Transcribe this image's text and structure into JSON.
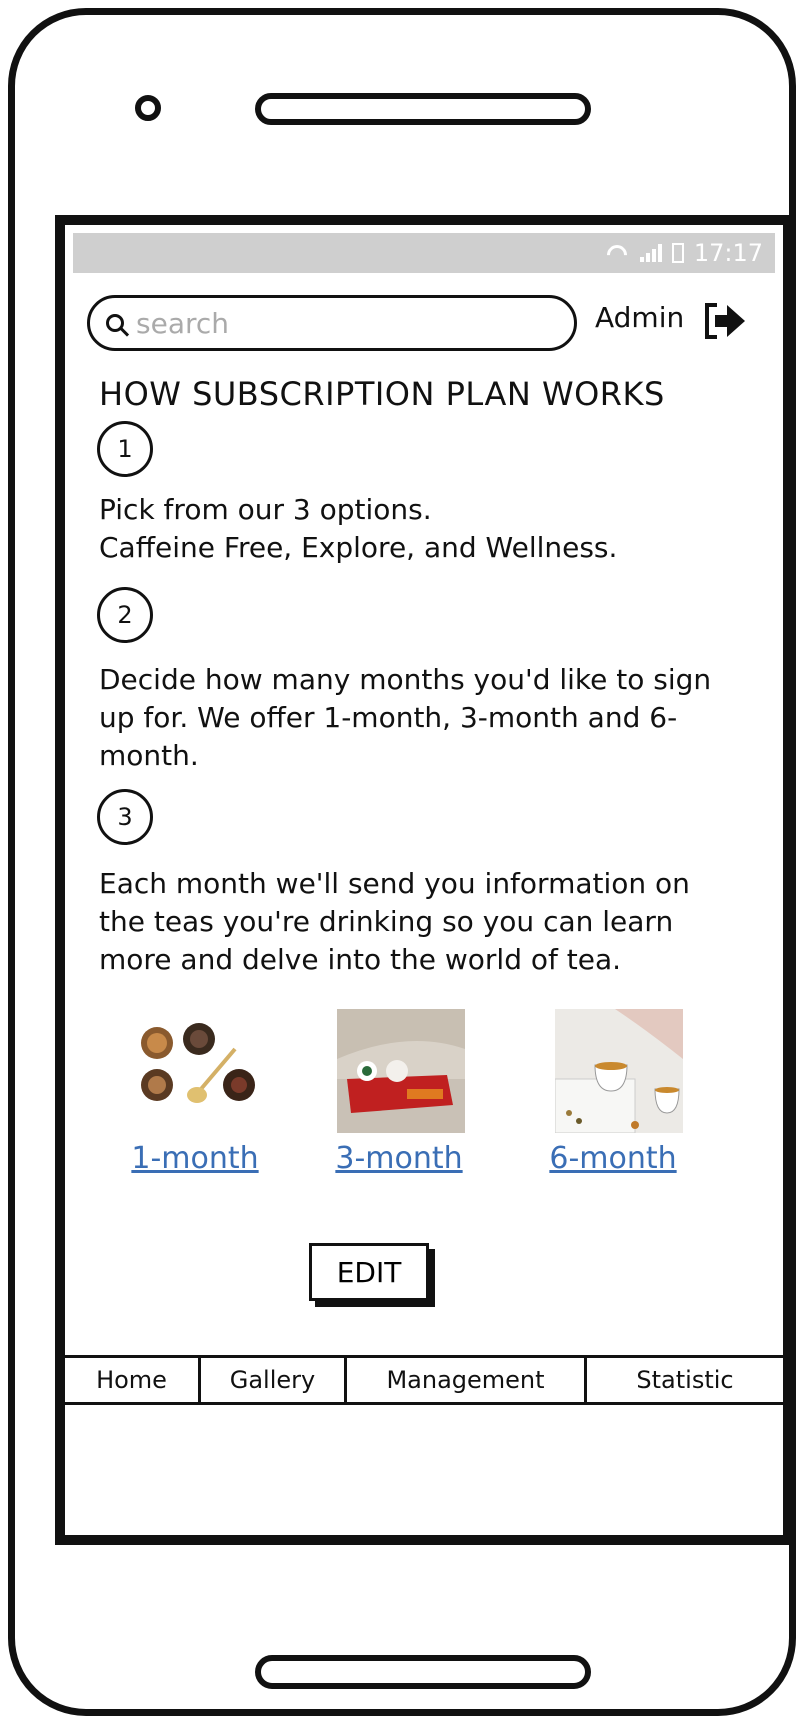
{
  "status": {
    "time": "17:17"
  },
  "search": {
    "placeholder": "search"
  },
  "header": {
    "user_label": "Admin"
  },
  "title": "HOW SUBSCRIPTION PLAN WORKS",
  "steps": [
    {
      "number": "1",
      "text_line1": "Pick from our 3 options.",
      "text_line2": "Caffeine Free, Explore, and Wellness."
    },
    {
      "number": "2",
      "text": "Decide how many months you'd like to sign up for. We offer 1-month, 3-month and 6-month."
    },
    {
      "number": "3",
      "text": "Each month we'll send you information on the teas you're drinking so you can learn more and delve into the world of tea."
    }
  ],
  "plans": [
    {
      "label": "1-month"
    },
    {
      "label": "3-month"
    },
    {
      "label": "6-month"
    }
  ],
  "edit_button": "EDIT",
  "tabs": [
    "Home",
    "Gallery",
    "Management",
    "Statistic"
  ]
}
